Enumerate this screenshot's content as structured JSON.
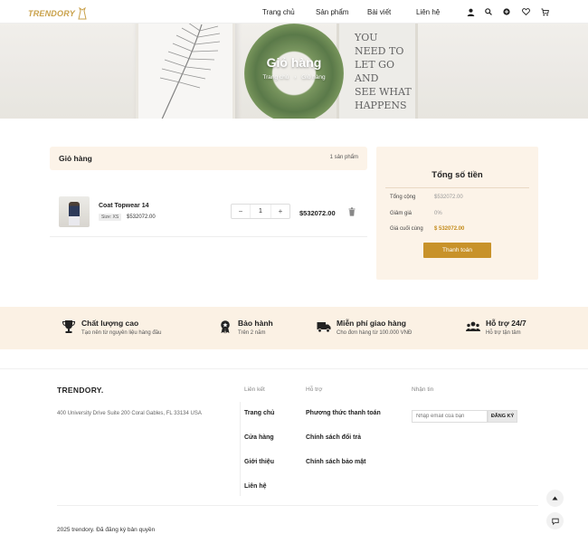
{
  "brand": {
    "logo_text": "TRENDORY"
  },
  "nav": {
    "items": [
      "Trang chủ",
      "Sản phẩm",
      "Bài viết",
      "Liên hệ"
    ]
  },
  "header_icons": [
    "user-icon",
    "search-icon",
    "plus-circle-icon",
    "heart-icon",
    "cart-icon"
  ],
  "banner": {
    "title": "Giỏ hàng",
    "breadcrumb": [
      "Trang chủ",
      "Giỏ hàng"
    ],
    "quote_lines": [
      "YOU",
      "NEED TO",
      "LET GO",
      "AND",
      "SEE WHAT",
      "HAPPENS"
    ]
  },
  "cart": {
    "heading": "Giỏ hàng",
    "count_label": "1 sản phẩm",
    "items": [
      {
        "name": "Coat Topwear 14",
        "size": "Size: XS",
        "price": "$532072.00",
        "quantity": "1",
        "line_total": "$532072.00"
      }
    ],
    "qty_minus": "−",
    "qty_plus": "+"
  },
  "summary": {
    "title": "Tổng số tiền",
    "rows": [
      {
        "label": "Tổng cộng",
        "value": "$532072.00"
      },
      {
        "label": "Giảm giá",
        "value": "0%"
      },
      {
        "label": "Giá cuối cùng",
        "value": "$ 532072.00"
      }
    ],
    "pay_button": "Thanh toán"
  },
  "features": [
    {
      "icon": "trophy-icon",
      "title": "Chất lượng cao",
      "subtitle": "Tạo nên từ nguyên liệu hàng đầu"
    },
    {
      "icon": "award-badge-icon",
      "title": "Bảo hành",
      "subtitle": "Trên 2 năm"
    },
    {
      "icon": "truck-icon",
      "title": "Miễn phí giao hàng",
      "subtitle": "Cho đơn hàng từ 100.000 VNĐ"
    },
    {
      "icon": "support-users-icon",
      "title": "Hỗ trợ 24/7",
      "subtitle": "Hỗ trợ tận tâm"
    }
  ],
  "footer": {
    "brand": "TRENDORY.",
    "address": "400 University Drive Suite 200 Coral Gables, FL 33134 USA",
    "links_heading": "Liên kết",
    "links": [
      "Trang chủ",
      "Cửa hàng",
      "Giới thiệu",
      "Liên hệ"
    ],
    "support_heading": "Hỗ trợ",
    "support_links": [
      "Phương thức thanh toán",
      "Chính sách đổi trả",
      "Chính sách bảo mật"
    ],
    "newsletter_heading": "Nhận tin",
    "email_placeholder": "Nhập email của bạn",
    "subscribe_button": "ĐĂNG KÝ",
    "copyright": "2025 trendory. Đã đăng ký bản quyền"
  },
  "colors": {
    "accent": "#c8922a",
    "soft_bg": "#fcf3e8",
    "logo": "#c9a14a"
  }
}
